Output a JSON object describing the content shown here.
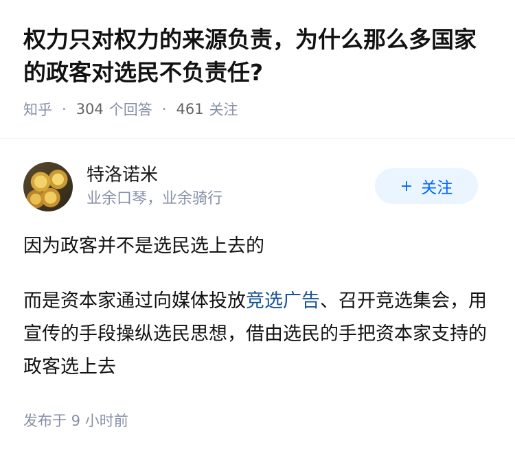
{
  "question": {
    "title": "权力只对权力的来源负责，为什么那么多国家的政客对选民不负责任?",
    "source": "知乎",
    "answer_count": "304",
    "answer_label": "个回答",
    "follower_count": "461",
    "follower_label": "关注"
  },
  "answer": {
    "author": {
      "name": "特洛诺米",
      "bio": "业余口琴，业余骑行"
    },
    "follow_button": {
      "icon": "+",
      "label": "关注"
    },
    "paragraph1": "因为政客并不是选民选上去的",
    "paragraph2_before": "而是资本家通过向媒体投放",
    "paragraph2_link": "竞选广告",
    "paragraph2_after": "、召开竞选集会，用宣传的手段操纵选民思想，借由选民的手把资本家支持的政客选上去",
    "posted": "发布于 9 小时前"
  },
  "colors": {
    "accent": "#0066ff",
    "link": "#175199",
    "meta": "#8590a6"
  }
}
